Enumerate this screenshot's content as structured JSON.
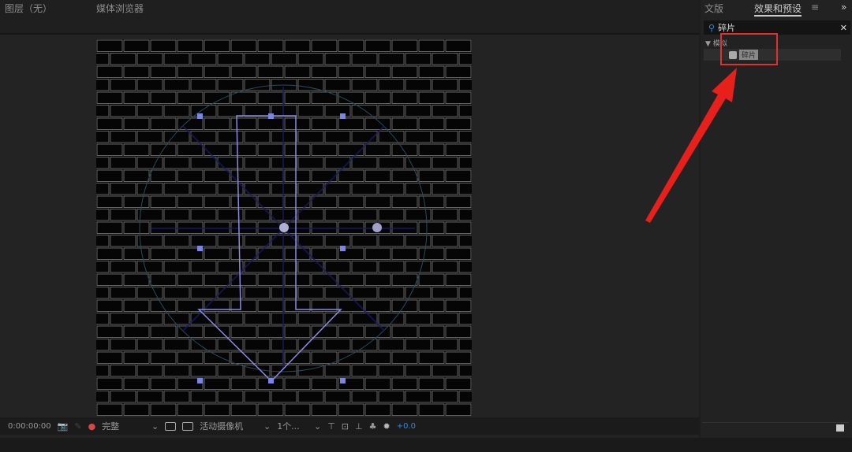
{
  "panels": {
    "layer_tab": "图层（无）",
    "media_browser_tab": "媒体浏览器"
  },
  "right_panel": {
    "tab_library": "文版",
    "tab_effects": "效果和预设",
    "menu_icon": "≡",
    "expand_icon": "»",
    "search_value": "碎片",
    "category": "模拟",
    "effect_item": "碎片"
  },
  "toolbar": {
    "timecode": "0:00:00:00",
    "resolution": "完整",
    "camera": "活动摄像机",
    "views": "1个...",
    "exposure": "+0.0"
  },
  "colors": {
    "accent": "#2d8ceb",
    "highlight_box": "#e0312f",
    "arrow": "#e8201c",
    "mask": "#8a8ae0"
  }
}
